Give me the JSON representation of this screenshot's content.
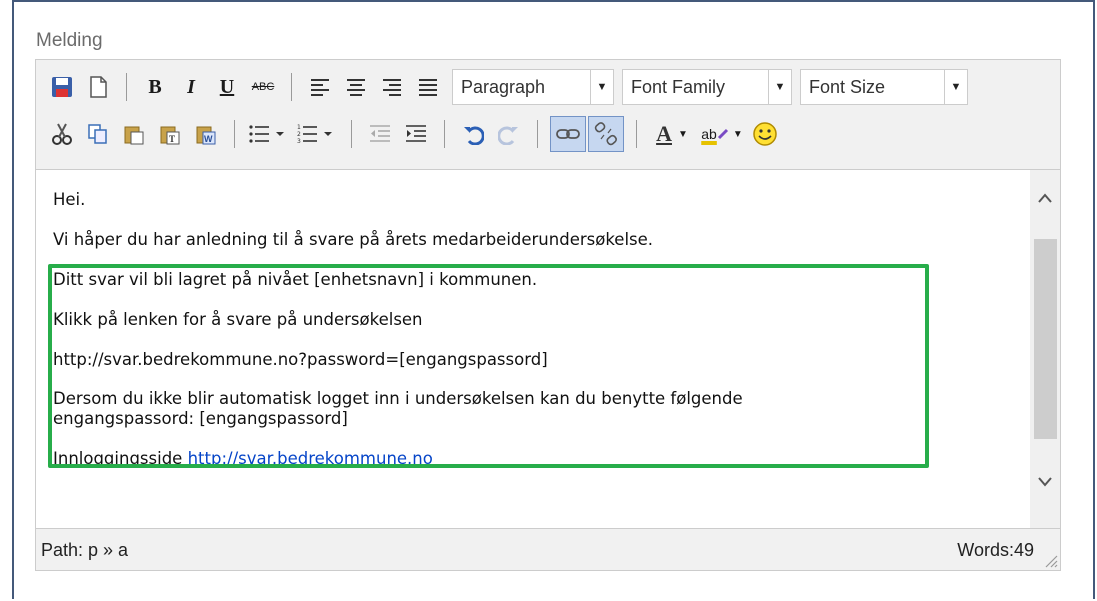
{
  "field_label": "Melding",
  "toolbar": {
    "paragraph": "Paragraph",
    "font_family": "Font Family",
    "font_size": "Font Size",
    "bold": "B",
    "italic": "I",
    "underline": "U",
    "strike": "ABC",
    "text_color": "A",
    "highlight": "ab"
  },
  "content": {
    "p1": "Hei.",
    "p2": "Vi håper du har anledning til å svare på årets medarbeiderundersøkelse.",
    "p3": "Ditt svar vil bli lagret på nivået [enhetsnavn] i kommunen.",
    "p4": "Klikk på lenken for å svare på undersøkelsen",
    "p5": "http://svar.bedrekommune.no?password=[engangspassord]",
    "p6_line1": "Dersom du ikke blir automatisk logget inn i undersøkelsen kan du benytte følgende",
    "p6_line2": "engangspassord: [engangspassord]",
    "p7_text": "Innloggingsside ",
    "p7_link": "http://svar.bedrekommune.no"
  },
  "status": {
    "path": "Path: p » a",
    "words": "Words:49"
  },
  "colors": {
    "highlight_box": "#27ad4a",
    "link": "#0645c8",
    "active_button": "#c6d7f0"
  }
}
